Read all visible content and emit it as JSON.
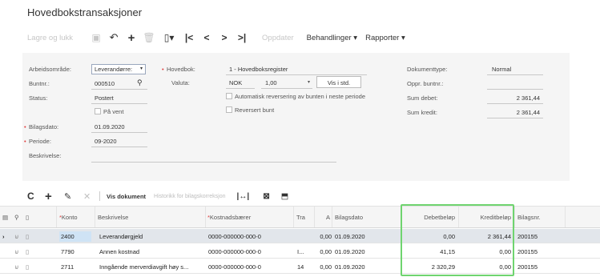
{
  "page": {
    "title": "Hovedbokstransaksjoner"
  },
  "toolbar": {
    "save_close": "Lagre og lukk",
    "refresh": "Oppdater",
    "actions": "Behandlinger",
    "reports": "Rapporter",
    "save_icon": "save-icon",
    "undo_icon": "undo-icon",
    "add_icon": "plus-icon",
    "delete_icon": "trash-icon",
    "copy_icon": "clipboard-icon",
    "first_icon": "first-page-icon",
    "prev_icon": "previous-icon",
    "next_icon": "next-icon",
    "last_icon": "last-page-icon"
  },
  "form": {
    "work_area_label": "Arbeidsområde:",
    "work_area_value": "Leverandørre:",
    "batch_no_label": "Buntnr.:",
    "batch_no_value": "000510",
    "status_label": "Status:",
    "status_value": "Postert",
    "on_hold_label": "På vent",
    "doc_date_label": "Bilagsdato:",
    "doc_date_value": "01.09.2020",
    "period_label": "Periode:",
    "period_value": "09-2020",
    "description_label": "Beskrivelse:",
    "ledger_label": "Hovedbok:",
    "ledger_value": "1 - Hovedboksregister",
    "currency_label": "Valuta:",
    "currency_value": "NOK",
    "rate_value": "1,00",
    "show_currency_button": "Vis i std.",
    "auto_reverse_label": "Automatisk reversering av bunten i neste periode",
    "reversed_label": "Reversert bunt",
    "doc_type_label": "Dokumenttype:",
    "doc_type_value": "Normal",
    "orig_batch_label": "Oppr. buntnr.:",
    "sum_debit_label": "Sum debet:",
    "sum_debit_value": "2 361,44",
    "sum_credit_label": "Sum kredit:",
    "sum_credit_value": "2 361,44"
  },
  "grid_toolbar": {
    "refresh_icon": "refresh-icon",
    "add_icon": "plus-icon",
    "edit_icon": "pencil-icon",
    "delete_icon": "close-icon",
    "view_document": "Vis dokument",
    "history": "Historikk for bilagskorreksjon",
    "fit_icon": "fit-columns-icon",
    "excel_icon": "excel-icon",
    "upload_icon": "upload-icon"
  },
  "grid": {
    "columns": {
      "account": "Konto",
      "description": "Beskrivelse",
      "cost": "Kostnadsbærer",
      "tx": "Tra",
      "a": "A",
      "date": "Bilagsdato",
      "debit": "Debetbeløp",
      "credit": "Kreditbeløp",
      "doc": "Bilagsnr."
    },
    "rows": [
      {
        "account": "2400",
        "description": "Leverandørgjeld",
        "cost": "0000-000000-000-0",
        "tx": "",
        "a": "0,00",
        "date": "01.09.2020",
        "debit": "0,00",
        "credit": "2 361,44",
        "doc": "200155"
      },
      {
        "account": "7790",
        "description": "Annen kostnad",
        "cost": "0000-000000-000-0",
        "tx": "I...",
        "a": "0,00",
        "date": "01.09.2020",
        "debit": "41,15",
        "credit": "0,00",
        "doc": "200155"
      },
      {
        "account": "2711",
        "description": "Inngående merverdiavgift høy s...",
        "cost": "0000-000000-000-0",
        "tx": "14",
        "a": "0,00",
        "date": "01.09.2020",
        "debit": "2 320,29",
        "credit": "0,00",
        "doc": "200155"
      }
    ]
  },
  "colors": {
    "highlight": "#6fd46f",
    "selected_row": "#e2e6eb",
    "required_star": "#e03c3c"
  }
}
